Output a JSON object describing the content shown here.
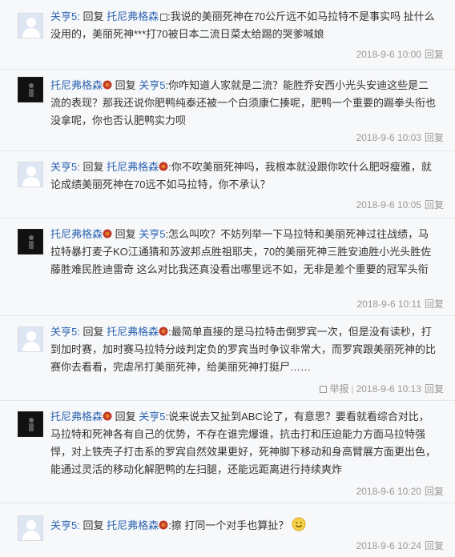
{
  "reply_word": "回复",
  "reply_link": "回复",
  "report_link": "举报",
  "comments": [
    {
      "author": "关亨5:",
      "target": "托尼弗格森",
      "avatar": "default",
      "prefix": " 回复 ",
      "content": ":我说的美丽死神在70公斤远不如马拉特不是事实吗 扯什么没用的，美丽死神***打70被日本二流日菜太给踢的哭爹喊娘",
      "time": "2018-9-6 10:00"
    },
    {
      "author": "托尼弗格森",
      "target": "关亨5",
      "avatar": "dark",
      "prefix": " 回复 ",
      "content": ":你咋知道人家就是二流？能胜乔安西小光头安迪这些是二流的表现？那我还说你肥鸭纯泰还被一个白须康仁揍呢，肥鸭一个重要的踢拳头衔也没拿呢，你也否认肥鸭实力呗",
      "time": "2018-9-6 10:03"
    },
    {
      "author": "关亨5:",
      "target": "托尼弗格森",
      "avatar": "default",
      "prefix": " 回复 ",
      "content": ":你不吹美丽死神吗，我根本就没跟你吹什么肥呀瘦雅，就论成绩美丽死神在70远不如马拉特，你不承认？",
      "time": "2018-9-6 10:05"
    },
    {
      "author": "托尼弗格森",
      "target": "关亨5",
      "avatar": "dark",
      "prefix": " 回复 ",
      "content": ":怎么叫吹？不妨列举一下马拉特和美丽死神过往战绩，马拉特暴打麦子KO江通猜和苏波邦点胜祖耶夫，70的美丽死神三胜安迪胜小光头胜佐藤胜难民胜迪雷奇 这么对比我还真没看出哪里远不如，无非是差个重要的冠军头衔",
      "time": "2018-9-6 10:11"
    },
    {
      "author": "关亨5:",
      "target": "托尼弗格森",
      "avatar": "default",
      "prefix": " 回复 ",
      "content": ":最简单直接的是马拉特击倒罗宾一次，但是没有读秒，打到加时赛，加时赛马拉特分歧判定负的罗宾当时争议非常大，而罗宾跟美丽死神的比赛你去看看，完虐吊打美丽死神，给美丽死神打挺尸……",
      "time": "2018-9-6 10:13",
      "has_report": true
    },
    {
      "author": "托尼弗格森",
      "target": "关亨5",
      "avatar": "dark",
      "prefix": " 回复 ",
      "content": ":说来说去又扯到ABC论了，有意思？要看就看综合对比，马拉特和死神各有自己的优势，不存在谁完爆谁，抗击打和压迫能力方面马拉特强悍，对上铁壳子打击系的罗宾自然效果更好，死神脚下移动和身高臂展方面更出色，能通过灵活的移动化解肥鸭的左扫腿，还能远距离进行持续爽炸",
      "time": "2018-9-6 10:20"
    },
    {
      "author": "关亨5:",
      "target": "托尼弗格森",
      "avatar": "default",
      "prefix": " 回复 ",
      "content": ":擦 打同一个对手也算扯？",
      "time": "2018-9-6 10:24"
    }
  ]
}
